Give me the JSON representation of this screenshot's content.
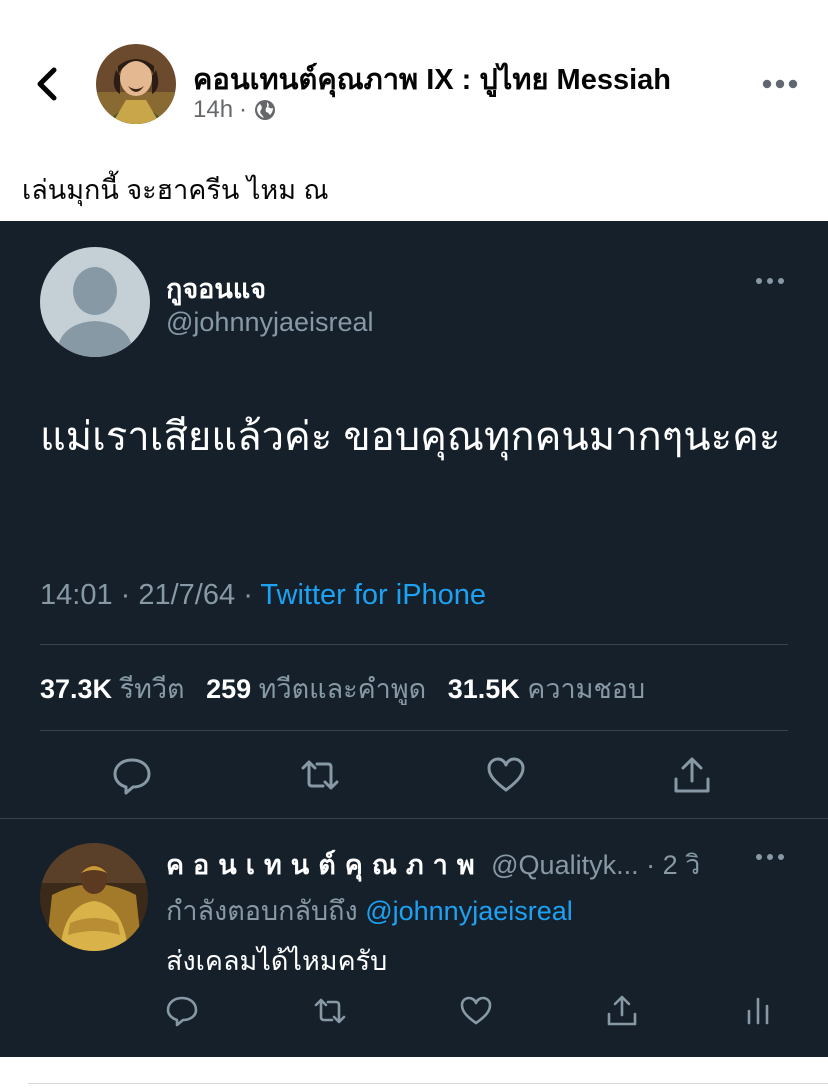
{
  "post": {
    "page_name": "คอนเทนต์คุณภาพ IX : ปูไทย Messiah",
    "time": "14h",
    "separator": "·",
    "caption": "เล่นมุกนี้ จะฮาครีน ไหม ณ",
    "privacy_icon": "globe-icon"
  },
  "tweet": {
    "name": "กูจอนแจ",
    "handle": "@johnnyjaeisreal",
    "text": "แม่เราเสียแล้วค่ะ ขอบคุณทุกคนมากๆนะคะ",
    "time": "14:01",
    "date": "21/7/64",
    "source": "Twitter for iPhone",
    "stats": {
      "retweets_count": "37.3K",
      "retweets_label": "รีทวีต",
      "quotes_count": "259",
      "quotes_label": "ทวีตและคำพูด",
      "likes_count": "31.5K",
      "likes_label": "ความชอบ"
    }
  },
  "reply": {
    "name": "คอนเทนต์คุณภาพ",
    "handle": "@Qualityk...",
    "time_sep": "·",
    "time": "2 วิ",
    "replying_label": "กำลังตอบกลับถึง",
    "replying_to": "@johnnyjaeisreal",
    "text": "ส่งเคลมได้ไหมครับ"
  },
  "colors": {
    "twitter_bg": "#15202b",
    "accent": "#1da1f2",
    "muted": "#8899a6"
  }
}
